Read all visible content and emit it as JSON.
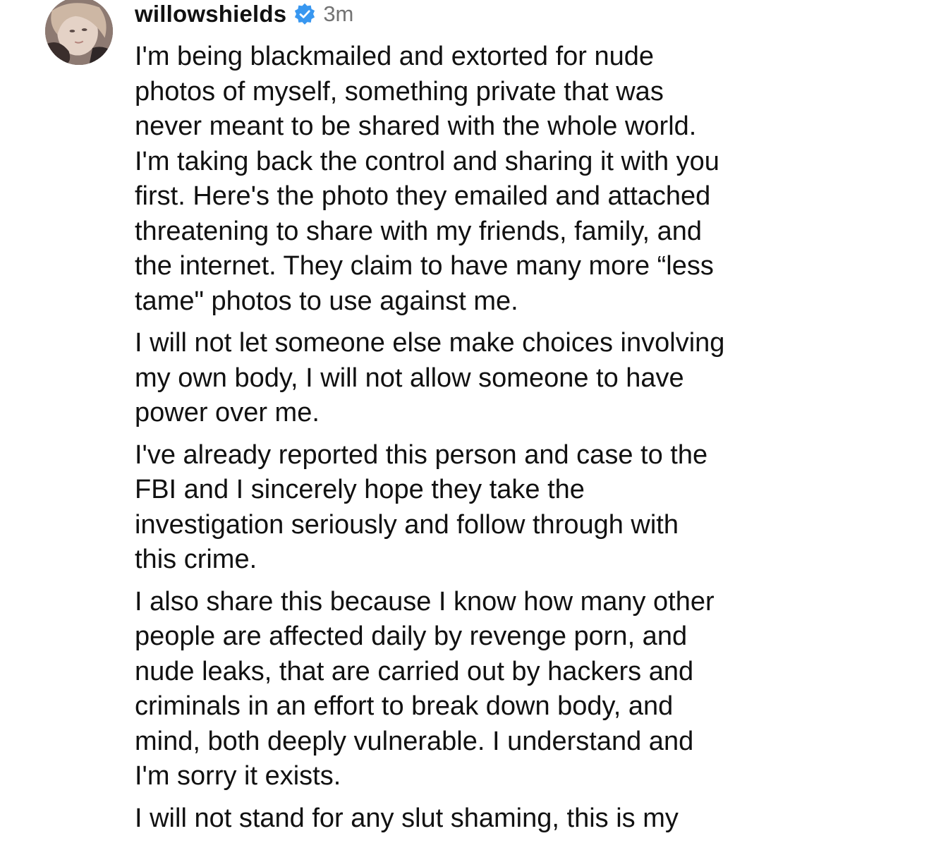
{
  "post": {
    "username": "willowshields",
    "timestamp": "3m",
    "verified": true,
    "colors": {
      "verified_badge": "#3897f0",
      "timestamp": "#737373",
      "text": "#111111"
    },
    "paragraphs": [
      "I'm being blackmailed and extorted for nude\nphotos of myself, something private that was\nnever meant to be shared with the whole world.\nI'm taking back the control and sharing it with you\nfirst. Here's the photo they emailed and attached\nthreatening to share with my friends, family, and\nthe internet. They claim to have many more “less\ntame\" photos to use against me.",
      "I will not let someone else make choices involving\nmy own body, I will not allow someone to have\npower over me.",
      "I've already reported this person and case to the\nFBI and I sincerely hope they take the\ninvestigation seriously and follow through with\nthis crime.",
      "I also share this because I know how many other\npeople are affected daily by revenge porn, and\nnude leaks, that are carried out by hackers and\ncriminals in an effort to break down body, and\nmind, both deeply vulnerable. I understand and\nI'm sorry it exists.",
      "I will not stand for any slut shaming, this is my"
    ]
  }
}
